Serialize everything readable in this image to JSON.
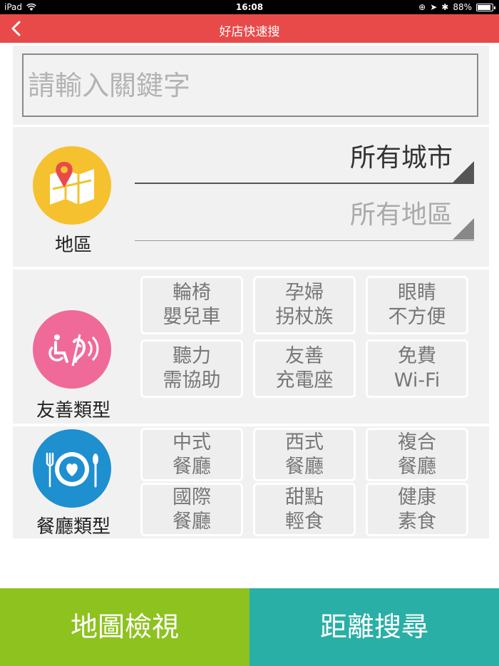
{
  "status_bar": {
    "device": "iPad",
    "time": "16:08",
    "battery": "88%",
    "battery_level": 0.88
  },
  "nav": {
    "title": "好店快速搜",
    "back_icon": "chevron-left-icon"
  },
  "search": {
    "placeholder": "請輸入關鍵字",
    "value": ""
  },
  "region": {
    "label": "地區",
    "icon": "map-pin-icon",
    "icon_color": "#f6c12e",
    "city_value": "所有城市",
    "district_value": "所有地區"
  },
  "friendly": {
    "label": "友善類型",
    "icon": "accessibility-icon",
    "icon_color": "#ef6a98",
    "options": [
      {
        "line1": "輪椅",
        "line2": "嬰兒車"
      },
      {
        "line1": "孕婦",
        "line2": "拐杖族"
      },
      {
        "line1": "眼睛",
        "line2": "不方便"
      },
      {
        "line1": "聽力",
        "line2": "需協助"
      },
      {
        "line1": "友善",
        "line2": "充電座"
      },
      {
        "line1": "免費",
        "line2": "Wi-Fi"
      }
    ]
  },
  "dining": {
    "label": "餐廳類型",
    "icon": "dining-plate-icon",
    "icon_color": "#1e8fcf",
    "options": [
      {
        "line1": "中式",
        "line2": "餐廳"
      },
      {
        "line1": "西式",
        "line2": "餐廳"
      },
      {
        "line1": "複合",
        "line2": "餐廳"
      },
      {
        "line1": "國際",
        "line2": "餐廳"
      },
      {
        "line1": "甜點",
        "line2": "輕食"
      },
      {
        "line1": "健康",
        "line2": "素食"
      }
    ]
  },
  "bottom": {
    "map_view_label": "地圖檢視",
    "distance_search_label": "距離搜尋"
  },
  "colors": {
    "nav_bg": "#e84a4a",
    "map_button": "#8dc21f",
    "distance_button": "#29afa6"
  }
}
